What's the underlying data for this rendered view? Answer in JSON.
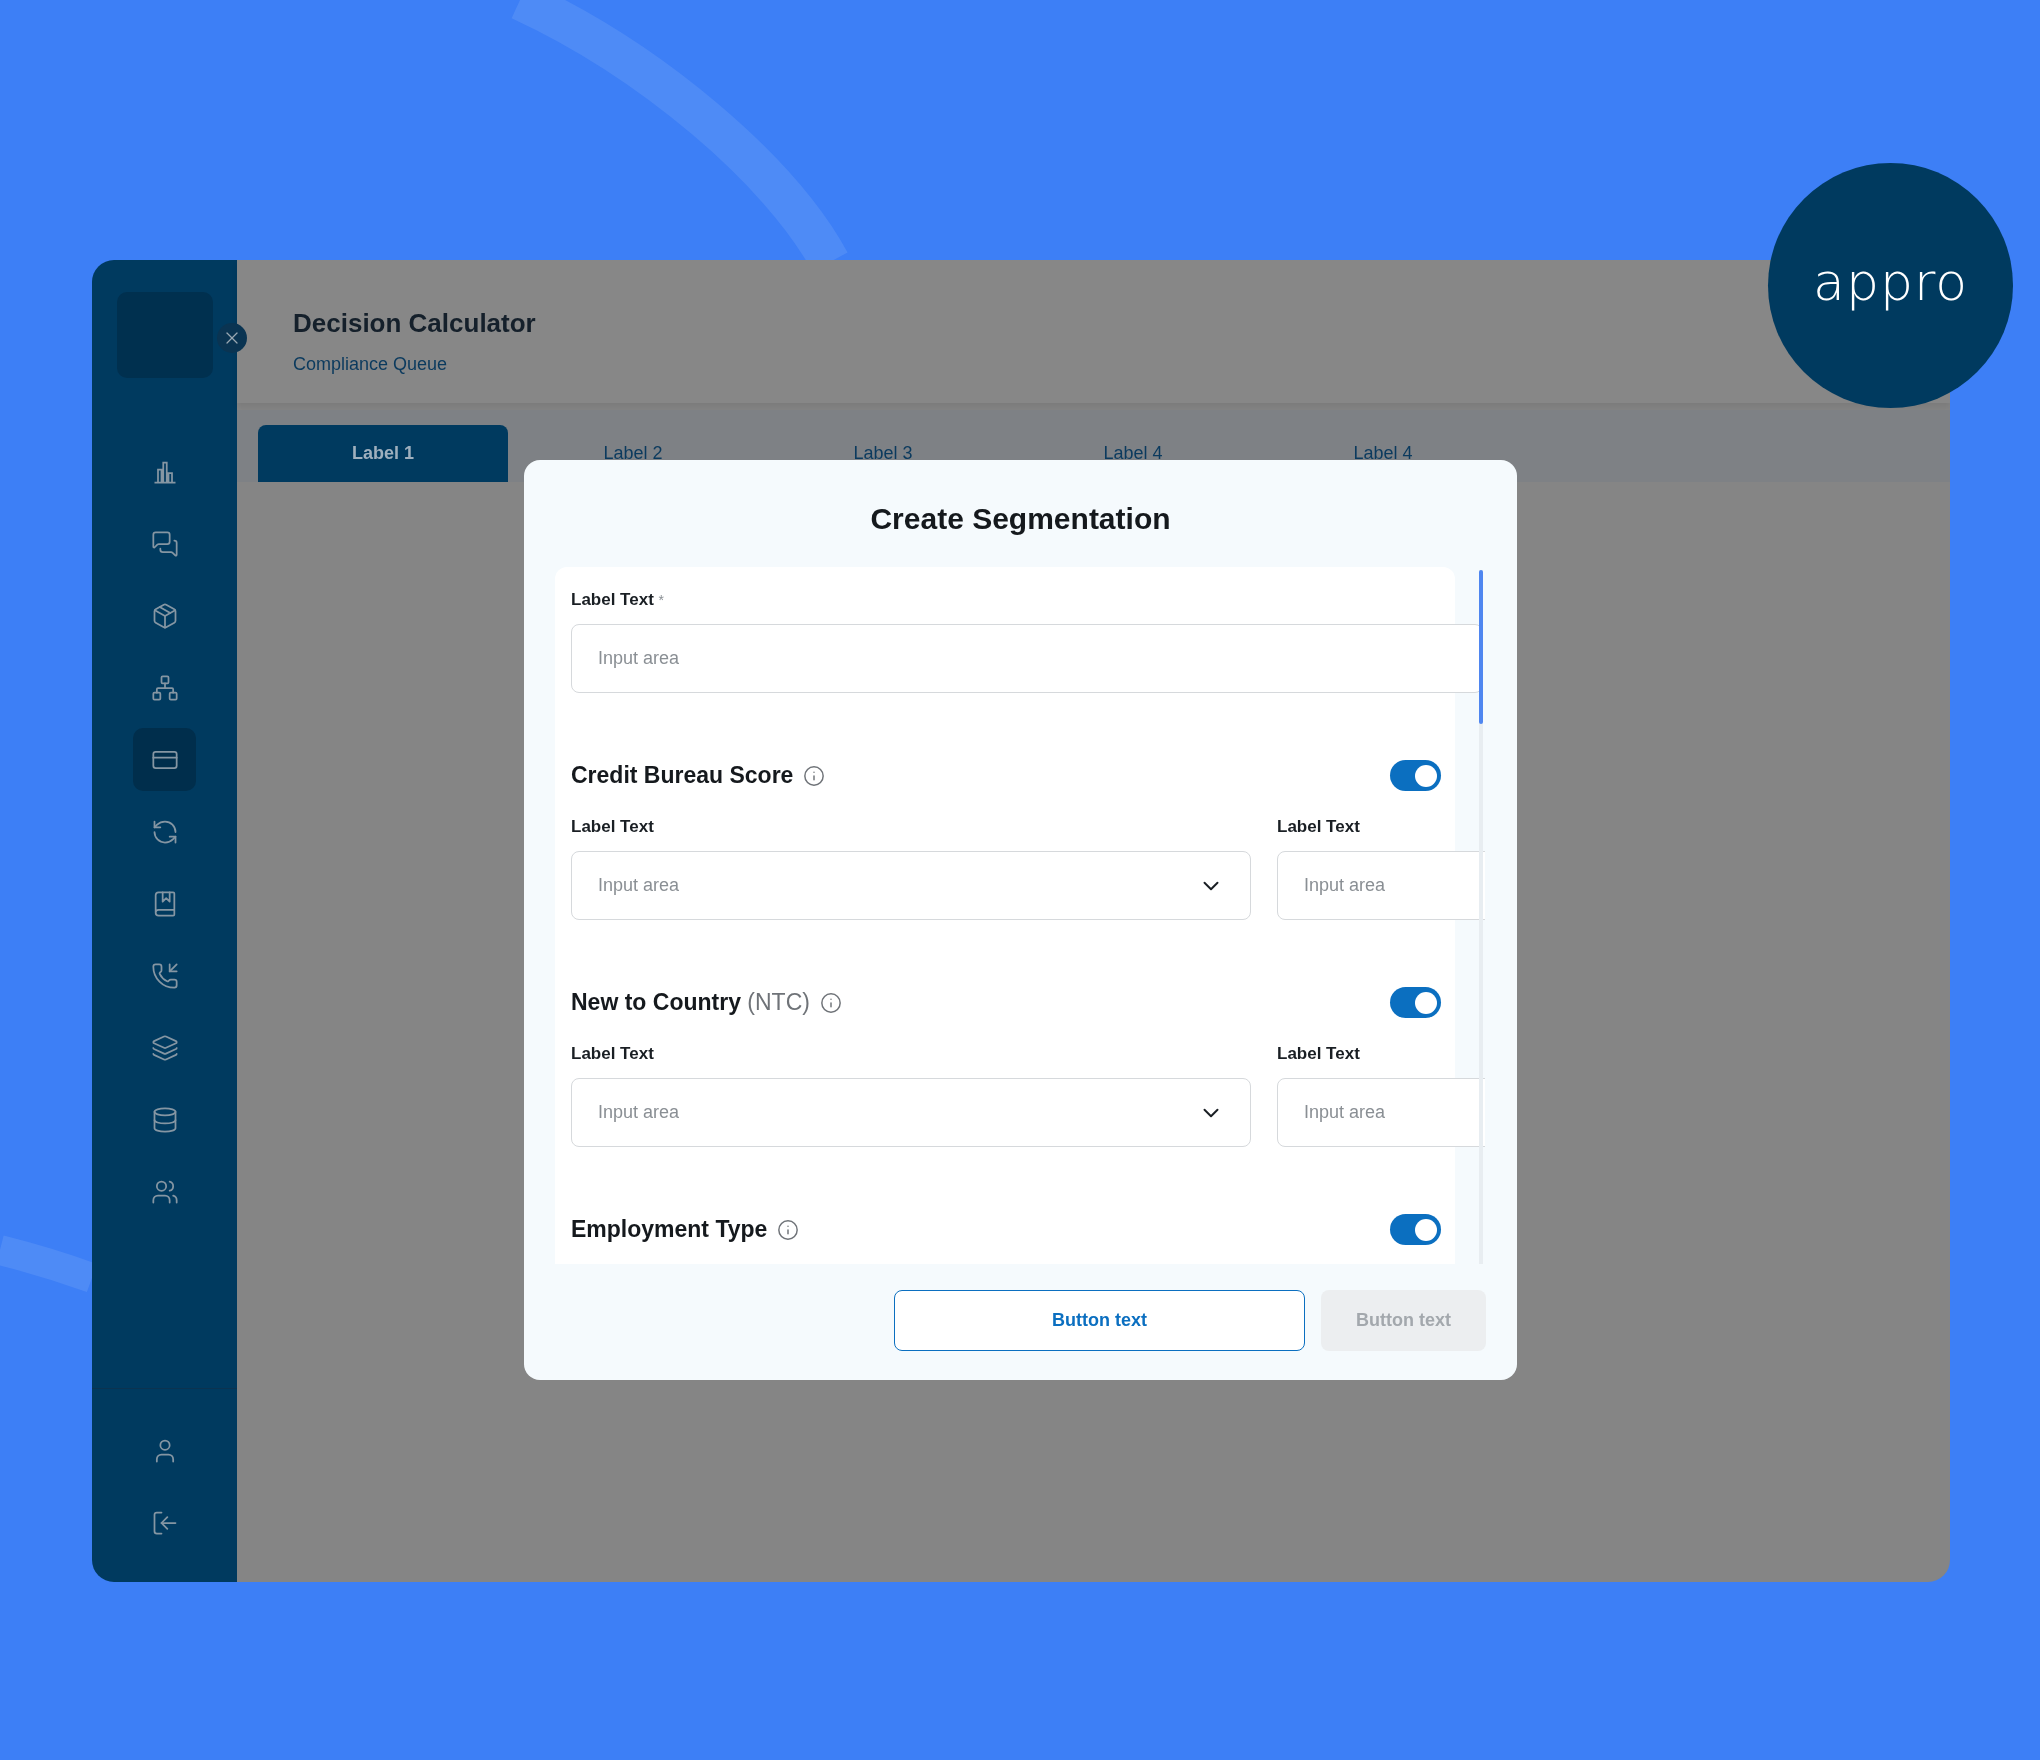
{
  "brand": {
    "logo": "appro"
  },
  "header": {
    "title": "Decision Calculator",
    "subtitle": "Compliance Queue"
  },
  "sidebar": {
    "items": [
      {
        "selected": false
      },
      {
        "selected": false
      },
      {
        "selected": false
      },
      {
        "selected": false
      },
      {
        "selected": true
      },
      {
        "selected": false
      },
      {
        "selected": false
      },
      {
        "selected": false
      },
      {
        "selected": false
      },
      {
        "selected": false
      },
      {
        "selected": false
      }
    ]
  },
  "tabs": [
    {
      "label": "Label 1",
      "selected": true
    },
    {
      "label": "Label 2",
      "selected": false
    },
    {
      "label": "Label 3",
      "selected": false
    },
    {
      "label": "Label 4",
      "selected": false
    },
    {
      "label": "Label 4",
      "selected": false
    }
  ],
  "modal": {
    "title": "Create Segmentation",
    "field": {
      "label": "Label Text",
      "required_mark": "*",
      "placeholder": "Input area"
    },
    "sections": [
      {
        "title": "Credit Bureau Score",
        "on": true,
        "fields": [
          {
            "kind": "select",
            "label": "Label Text",
            "placeholder": "Input area"
          },
          {
            "kind": "text",
            "label": "Label Text",
            "placeholder": "Input area"
          }
        ]
      },
      {
        "title": "New to Country",
        "note": "(NTC)",
        "on": true,
        "fields": [
          {
            "kind": "select",
            "label": "Label Text",
            "placeholder": "Input area"
          },
          {
            "kind": "text",
            "label": "Label Text",
            "placeholder": "Input area"
          }
        ]
      },
      {
        "title": "Employment Type",
        "on": true
      }
    ],
    "buttons": [
      {
        "label": "Button text",
        "disabled": false
      },
      {
        "label": "Button text",
        "disabled": true
      }
    ]
  }
}
